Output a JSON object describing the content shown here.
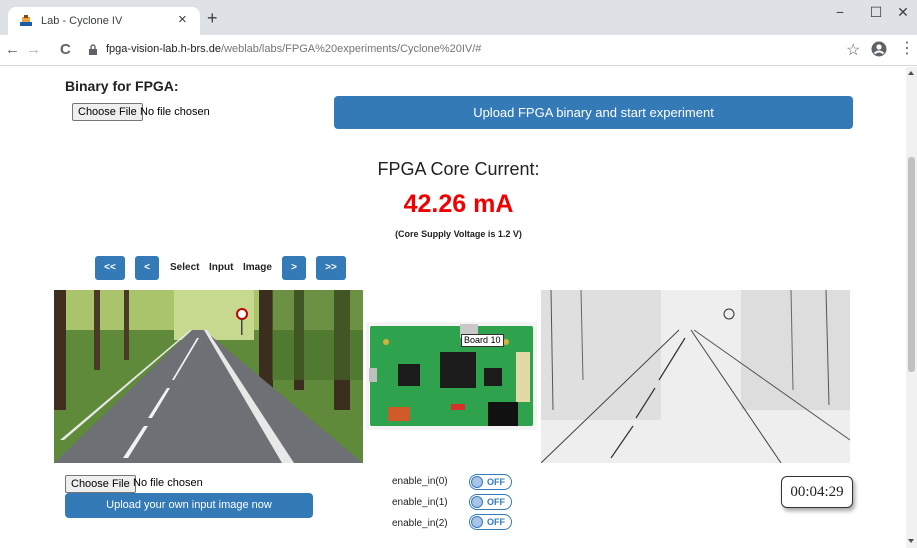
{
  "browser": {
    "tab_title": "Lab - Cyclone IV",
    "tab_close": "×",
    "new_tab": "+",
    "url_host": "fpga-vision-lab.h-brs.de",
    "url_path": "/weblab/labs/FPGA%20experiments/Cyclone%20IV/#",
    "back": "←",
    "forward": "→",
    "reload": "C",
    "star": "☆",
    "menu": "⋮",
    "minimize": "−",
    "maximize": "☐",
    "close": "✕"
  },
  "binary": {
    "title": "Binary for FPGA:",
    "choose_file": "Choose File",
    "status": "No file chosen",
    "upload_button": "Upload FPGA binary and start experiment"
  },
  "current": {
    "title": "FPGA Core Current:",
    "value": "42.26 mA",
    "note": "(Core Supply Voltage is 1.2 V)"
  },
  "image_nav": {
    "first": "<<",
    "prev": "<",
    "label_select": "Select",
    "label_input": "Input",
    "label_image": "Image",
    "next": ">",
    "last": ">>"
  },
  "board": {
    "label": "Board 10"
  },
  "own_image": {
    "choose_file": "Choose File",
    "status": "No file chosen",
    "upload_button": "Upload your own input image now"
  },
  "switches": [
    {
      "label": "enable_in(0)",
      "state": "OFF"
    },
    {
      "label": "enable_in(1)",
      "state": "OFF"
    },
    {
      "label": "enable_in(2)",
      "state": "OFF"
    }
  ],
  "timer": "00:04:29",
  "colors": {
    "accent": "#337ab7",
    "current_value": "#f00000"
  }
}
